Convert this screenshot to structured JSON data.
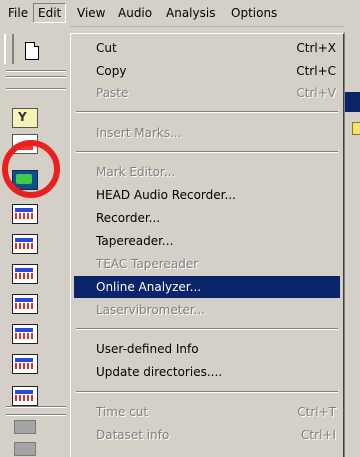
{
  "menubar": {
    "items": [
      "File",
      "Edit",
      "View",
      "Audio",
      "Analysis",
      "Options"
    ],
    "active_index": 1
  },
  "edit_menu": {
    "items": [
      {
        "label": "Cut",
        "shortcut": "Ctrl+X",
        "enabled": true
      },
      {
        "label": "Copy",
        "shortcut": "Ctrl+C",
        "enabled": true
      },
      {
        "label": "Paste",
        "shortcut": "Ctrl+V",
        "enabled": false
      },
      {
        "label": "Insert Marks...",
        "shortcut": "",
        "enabled": false
      },
      {
        "label": "Mark Editor...",
        "shortcut": "",
        "enabled": false
      },
      {
        "label": "HEAD Audio Recorder...",
        "shortcut": "",
        "enabled": true
      },
      {
        "label": "Recorder...",
        "shortcut": "",
        "enabled": true
      },
      {
        "label": "Tapereader...",
        "shortcut": "",
        "enabled": true
      },
      {
        "label": "TEAC Tapereader",
        "shortcut": "",
        "enabled": false
      },
      {
        "label": "Online Analyzer...",
        "shortcut": "",
        "enabled": true,
        "highlighted": true
      },
      {
        "label": "Laservibrometer...",
        "shortcut": "",
        "enabled": false
      },
      {
        "label": "User-defined Info",
        "shortcut": "",
        "enabled": true
      },
      {
        "label": "Update directories....",
        "shortcut": "",
        "enabled": true
      },
      {
        "label": "Time cut",
        "shortcut": "Ctrl+T",
        "enabled": false
      },
      {
        "label": "Dataset info",
        "shortcut": "Ctrl+I",
        "enabled": false
      }
    ]
  },
  "toolbar": {
    "icons": [
      "new-document-icon",
      "mark-icon",
      "edit-icon",
      "oscilloscope-icon",
      "recorder-icon",
      "recorder-icon",
      "recorder-icon",
      "recorder-icon",
      "recorder-icon",
      "recorder-icon",
      "recorder-icon",
      "gray-block-icon",
      "gray-block-icon"
    ]
  },
  "annotation": {
    "color": "#ea1f1f"
  }
}
